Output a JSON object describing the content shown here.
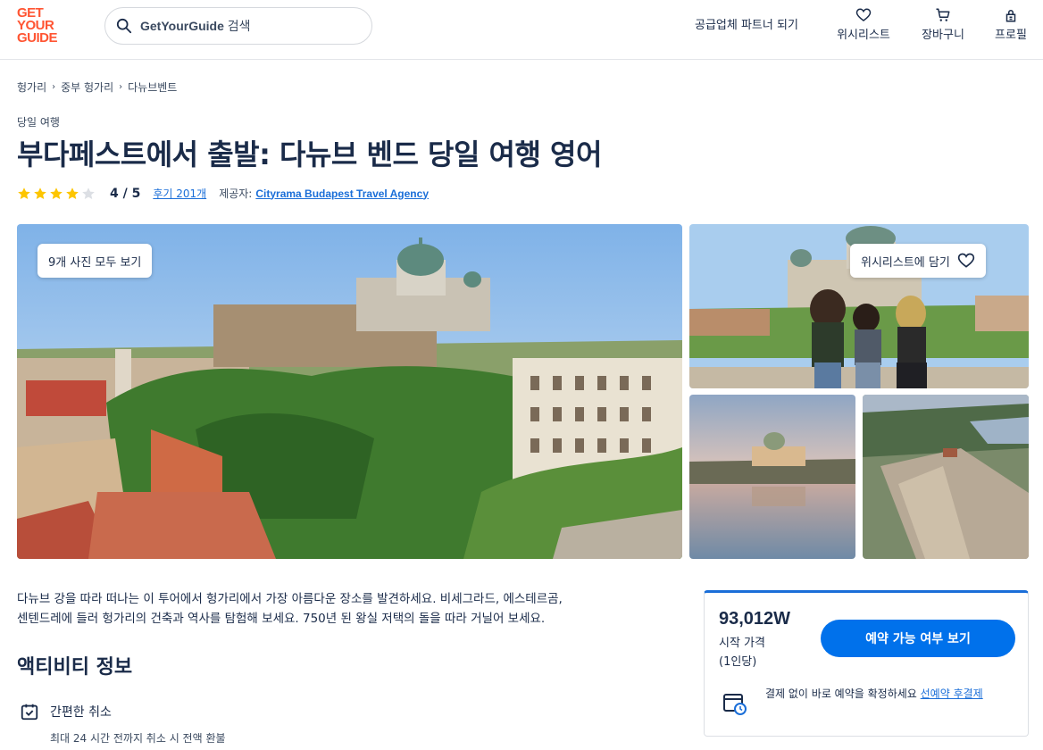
{
  "header": {
    "logo_lines": [
      "GET",
      "YOUR",
      "GUIDE"
    ],
    "search_placeholder_brand": "GetYourGuide",
    "search_placeholder_suffix": " 검색",
    "supplier_link": "공급업체 파트너 되기",
    "nav": {
      "wishlist": "위시리스트",
      "cart": "장바구니",
      "profile": "프로필"
    }
  },
  "breadcrumb": [
    "헝가리",
    "중부 헝가리",
    "다뉴브벤트"
  ],
  "activity": {
    "category": "당일 여행",
    "title": "부다페스트에서 출발: 다뉴브 벤드 당일 여행 영어",
    "rating_stars": 4,
    "rating_text": "4 / 5",
    "reviews_link": "후기 201개",
    "provider_label": "제공자:",
    "provider_name": "Cityrama Budapest Travel Agency"
  },
  "gallery": {
    "all_photos_button": "9개 사진 모두 보기",
    "wishlist_button": "위시리스트에 담기"
  },
  "description": {
    "line1": "다뉴브 강을 따라 떠나는 이 투어에서 헝가리에서 가장 아름다운 장소를 발견하세요. 비세그라드, 에스테르곰,",
    "line2": "센텐드레에 들러 헝가리의 건축과 역사를 탐험해 보세요. 750년 된 왕실 저택의 돌을 따라 거닐어 보세요."
  },
  "info": {
    "section_title": "액티비티 정보",
    "feature_title": "간편한 취소",
    "feature_sub": "최대 24 시간 전까지 취소 시 전액 환불"
  },
  "booking": {
    "price": "93,012W",
    "price_label_1": "시작 가격",
    "price_label_2": "(1인당)",
    "check_button": "예약 가능 여부 보기",
    "reserve_text": "결제 없이 바로 예약을 확정하세요 ",
    "reserve_link": "선예약 후결제"
  },
  "colors": {
    "brand": "#ff5533",
    "primary_button": "#0071eb",
    "link": "#1a6ed8",
    "star": "#fdc500",
    "text": "#1a2b49"
  }
}
